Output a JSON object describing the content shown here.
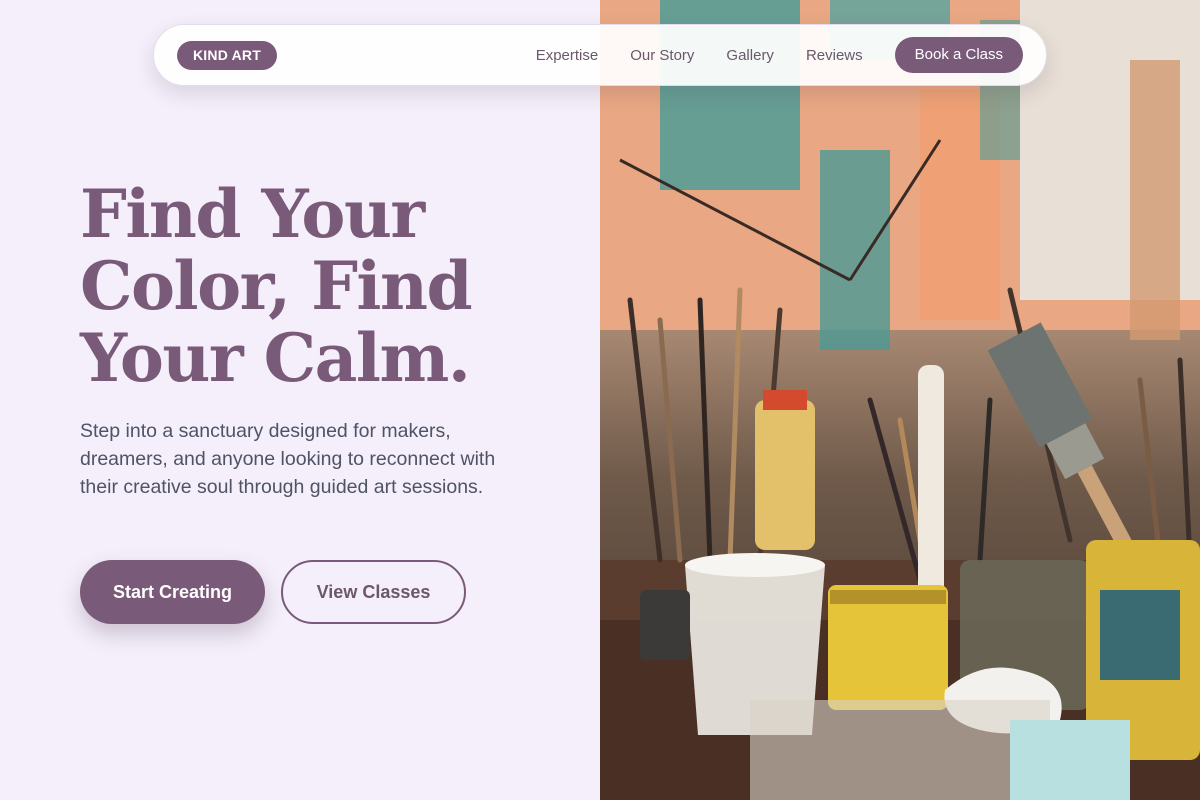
{
  "brand": {
    "logo_text": "KIND ART"
  },
  "nav": {
    "links": [
      "Expertise",
      "Our Story",
      "Gallery",
      "Reviews"
    ],
    "cta_label": "Book a Class"
  },
  "hero": {
    "title_lines": [
      "Find Your",
      "Color, Find",
      "Your Calm."
    ],
    "subtitle": "Step into a sanctuary designed for makers, dreamers, and anyone looking to reconnect with their creative soul through guided art sessions.",
    "primary_button": "Start Creating",
    "secondary_button": "View Classes"
  },
  "theme": {
    "accent": "#7a5a79",
    "background": "#f4effa",
    "body_text": "#4f5366"
  }
}
